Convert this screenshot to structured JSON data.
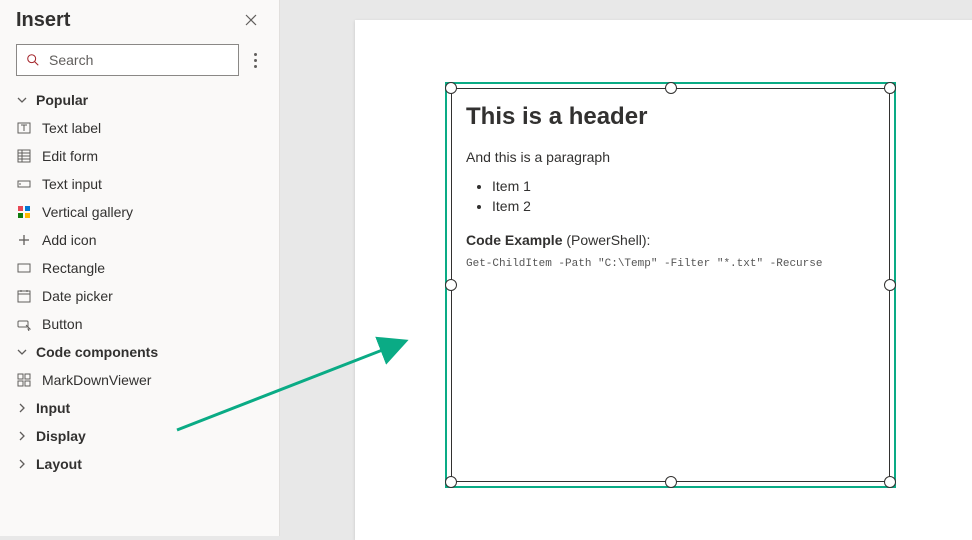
{
  "panel": {
    "title": "Insert",
    "search_placeholder": "Search"
  },
  "sections": {
    "popular": "Popular",
    "code_components": "Code components",
    "input": "Input",
    "display": "Display",
    "layout": "Layout"
  },
  "items": {
    "text_label": "Text label",
    "edit_form": "Edit form",
    "text_input": "Text input",
    "vertical_gallery": "Vertical gallery",
    "add_icon": "Add icon",
    "rectangle": "Rectangle",
    "date_picker": "Date picker",
    "button": "Button",
    "markdownviewer": "MarkDownViewer"
  },
  "preview": {
    "header": "This is a header",
    "paragraph": "And this is a paragraph",
    "list": [
      "Item 1",
      "Item 2"
    ],
    "code_label_bold": "Code Example",
    "code_label_rest": " (PowerShell):",
    "code": "Get-ChildItem -Path \"C:\\Temp\" -Filter \"*.txt\" -Recurse"
  }
}
